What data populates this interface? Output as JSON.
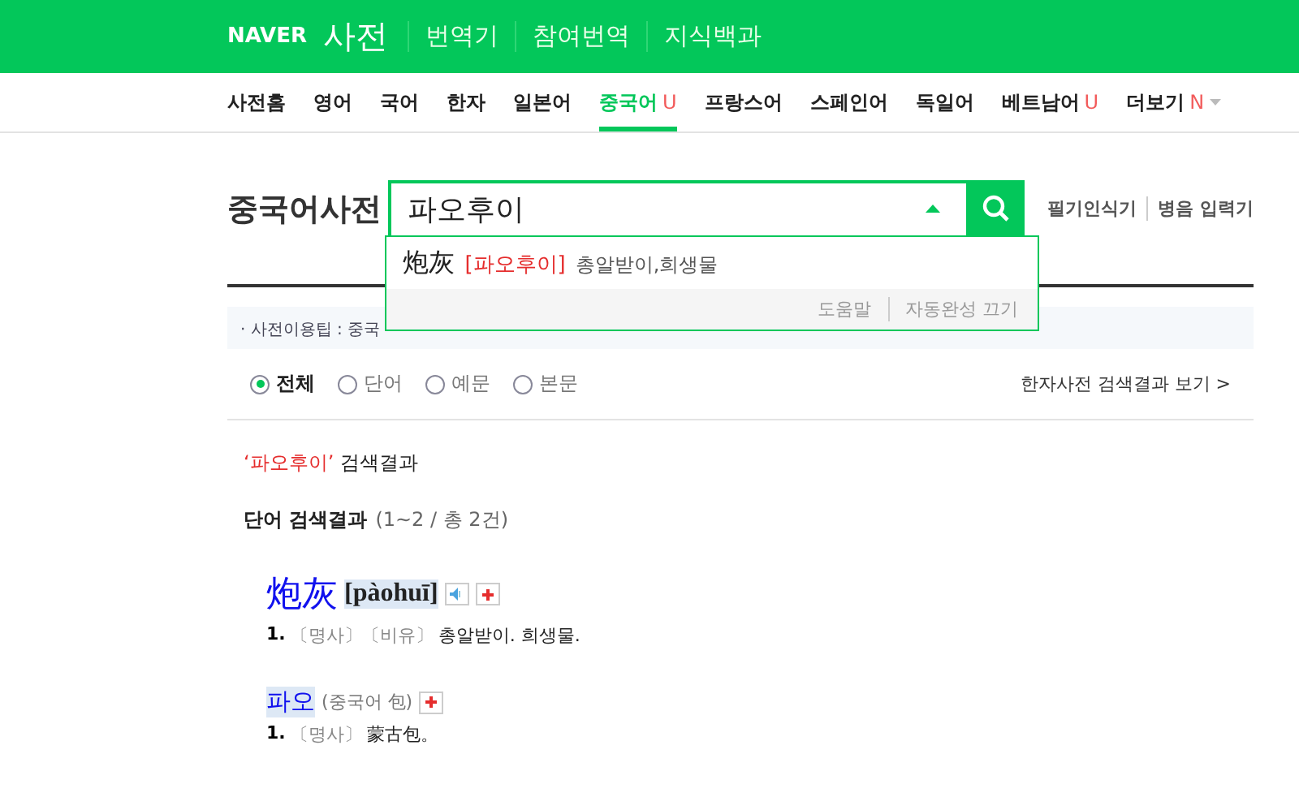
{
  "header": {
    "logo": "NAVER",
    "service": "사전",
    "links": [
      "번역기",
      "참여번역",
      "지식백과"
    ]
  },
  "nav": [
    {
      "label": "사전홈",
      "selected": false
    },
    {
      "label": "영어",
      "selected": false
    },
    {
      "label": "국어",
      "selected": false
    },
    {
      "label": "한자",
      "selected": false
    },
    {
      "label": "일본어",
      "selected": false
    },
    {
      "label": "중국어",
      "badge": "U",
      "selected": true
    },
    {
      "label": "프랑스어",
      "selected": false
    },
    {
      "label": "스페인어",
      "selected": false
    },
    {
      "label": "독일어",
      "selected": false
    },
    {
      "label": "베트남어",
      "badge": "U",
      "selected": false
    },
    {
      "label": "더보기",
      "badge": "N",
      "selected": false
    }
  ],
  "search": {
    "title": "중국어사전",
    "value": "파오후이",
    "side_links": [
      "필기인식기",
      "병음 입력기"
    ],
    "autocomplete": {
      "items": [
        {
          "hanzi": "炮灰",
          "reading": "[파오후이]",
          "meaning": "총알받이,희생물"
        }
      ],
      "footer": [
        "도움말",
        "자동완성 끄기"
      ]
    }
  },
  "tip": "· 사전이용팁 : 중국",
  "filters": {
    "options": [
      {
        "label": "전체",
        "selected": true
      },
      {
        "label": "단어",
        "selected": false
      },
      {
        "label": "예문",
        "selected": false
      },
      {
        "label": "본문",
        "selected": false
      }
    ],
    "link": "한자사전 검색결과 보기 >"
  },
  "query": {
    "term": "‘파오후이’",
    "suffix": "검색결과"
  },
  "section": {
    "title": "단어 검색결과",
    "count": "(1~2 / 총 2건)"
  },
  "entries": [
    {
      "kind": "hanzi",
      "headword": "炮灰",
      "pinyin": "[pàohuī]",
      "definitions": [
        {
          "num": "1.",
          "tags": "〔명사〕〔비유〕",
          "text": "총알받이. 희생물."
        }
      ]
    },
    {
      "kind": "hangul",
      "headword": "파오",
      "note": "(중국어 包)",
      "definitions": [
        {
          "num": "1.",
          "tags": "〔명사〕",
          "text": "蒙古包。"
        }
      ]
    }
  ]
}
